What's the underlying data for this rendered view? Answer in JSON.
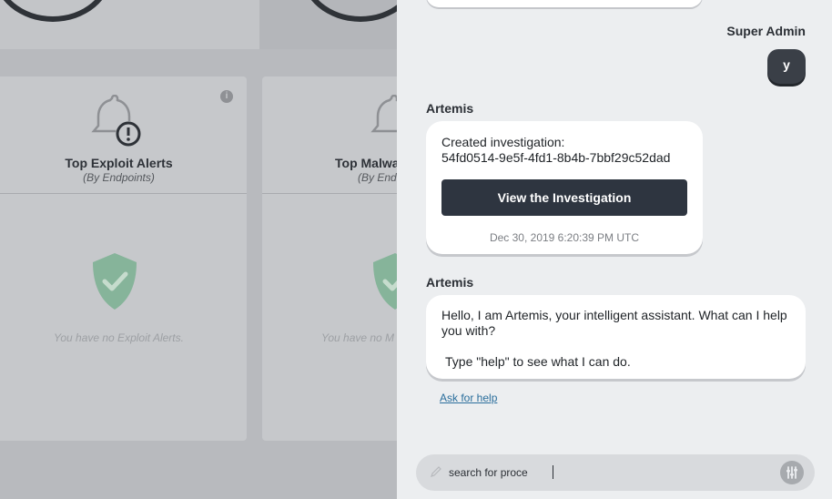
{
  "dashboard": {
    "cards": [
      {
        "title": "Top Exploit Alerts",
        "subtitle": "(By Endpoints)",
        "empty_text": "You have no Exploit Alerts."
      },
      {
        "title": "Top Malwa",
        "subtitle": "(By End",
        "empty_text": "You have no M"
      }
    ],
    "info_glyph": "i"
  },
  "chat": {
    "user": {
      "name": "Super Admin",
      "avatar_letter": "y"
    },
    "messages": [
      {
        "sender": "Artemis",
        "line1": "Created investigation:",
        "line2": "54fd0514-9e5f-4fd1-8b4b-7bbf29c52dad",
        "button_label": "View the Investigation",
        "timestamp": "Dec 30, 2019 6:20:39 PM UTC"
      },
      {
        "sender": "Artemis",
        "text": "Hello, I am Artemis, your intelligent assistant. What can I help you with?",
        "text2": "Type \"help\" to see what I can do."
      }
    ],
    "help_link": "Ask for help",
    "input": {
      "value": "search for proce",
      "placeholder": ""
    }
  },
  "colors": {
    "button_bg": "#2e3540",
    "link": "#2a6e9c",
    "shield_green": "#86b49a",
    "alert_red": "#c0392b"
  },
  "icons": [
    "bell-alert-icon",
    "shield-check-icon",
    "info-icon",
    "pencil-icon",
    "filter-icon"
  ]
}
